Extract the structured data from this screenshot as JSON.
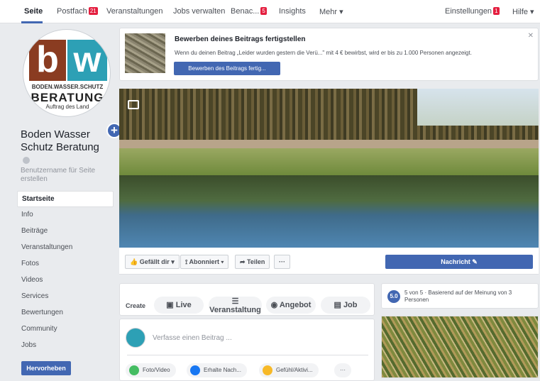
{
  "topnav": {
    "items": [
      {
        "label": "Seite",
        "active": true
      },
      {
        "label": "Postfach",
        "badge": "21"
      },
      {
        "label": "Veranstaltungen"
      },
      {
        "label": "Jobs verwalten"
      },
      {
        "label": "Benac...",
        "badge": "5"
      },
      {
        "label": "Insights"
      },
      {
        "label": "Mehr ▾"
      }
    ],
    "settings_label": "Einstellungen",
    "settings_badge": "1",
    "help_label": "Hilfe ▾"
  },
  "sidebar": {
    "logo": {
      "b": "b",
      "w": "w",
      "line1": "BODEN.WASSER.SCHUTZ",
      "line2": "BERATUNG",
      "line3": "Auftrag des Land"
    },
    "page_name": "Boden Wasser Schutz Beratung",
    "username_prompt": "Benutzername für Seite erstellen",
    "nav": [
      "Startseite",
      "Info",
      "Beiträge",
      "Veranstaltungen",
      "Fotos",
      "Videos",
      "Services",
      "Bewertungen",
      "Community",
      "Jobs"
    ],
    "promote_label": "Hervorheben"
  },
  "tip": {
    "title": "Bewerben deines Beitrags fertigstellen",
    "text": "Wenn du deinen Beitrag „Leider wurden gestern die Verü...\" mit 4 € bewirbst, wird er bis zu 1.000 Personen angezeigt.",
    "button": "Bewerben des Beitrags fertig..."
  },
  "actions": {
    "like": "👍 Gefällt dir ▾",
    "follow": "Abonniert ▾",
    "share": "➦ Teilen",
    "more": "···",
    "message": "Nachricht ✎"
  },
  "create": {
    "label": "Create",
    "live": "Live",
    "event": "Veranstaltung",
    "offer": "Angebot",
    "job": "Job"
  },
  "composer": {
    "placeholder": "Verfasse einen Beitrag ...",
    "photo": "Foto/Video",
    "message": "Erhalte Nach...",
    "feeling": "Gefühl/Aktivi...",
    "more": "···"
  },
  "right": {
    "rating": "5.0",
    "rating_text": "5 von 5 · Basierend auf der Meinung von 3 Personen"
  }
}
